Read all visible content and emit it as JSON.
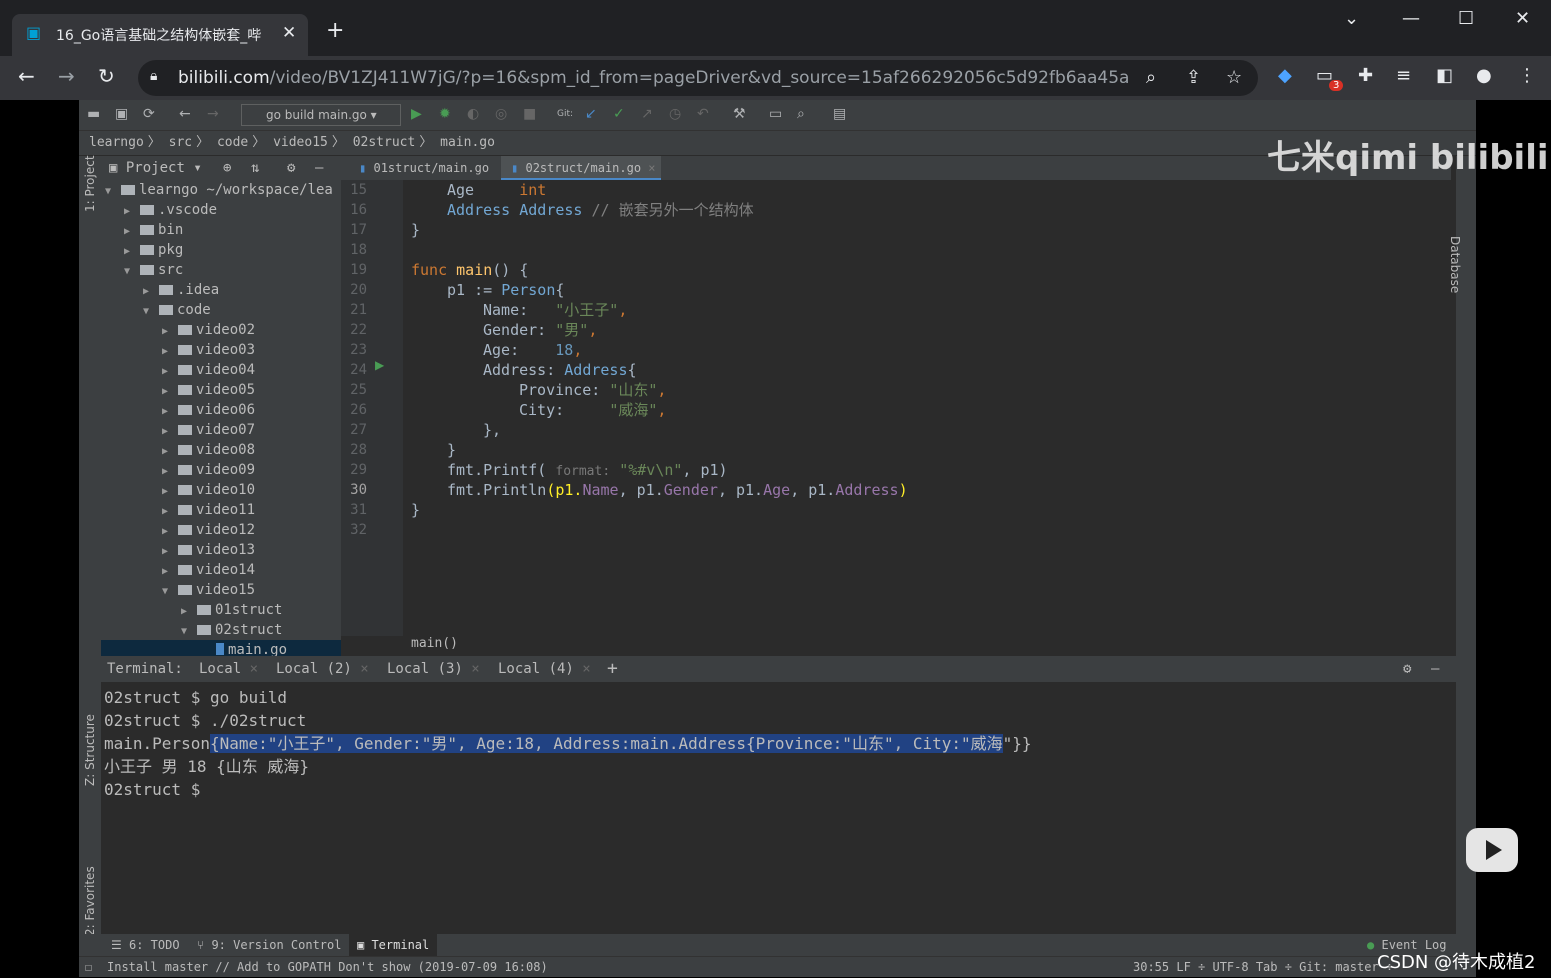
{
  "browser": {
    "tab_title": "16_Go语言基础之结构体嵌套_哔",
    "tab_close": "✕",
    "new_tab": "+",
    "url_host": "bilibili.com",
    "url_path": "/video/BV1ZJ411W7jG/?p=16&spm_id_from=pageDriver&vd_source=15af266292056c5d92fb6aa45a...",
    "extension_badge": "3"
  },
  "ide": {
    "run_config": "go build main.go",
    "git_label": "Git:",
    "breadcrumb": [
      "learngo",
      "src",
      "code",
      "video15",
      "02struct",
      "main.go"
    ],
    "project_panel": {
      "title": "Project",
      "side_label": "1: Project",
      "tree": [
        {
          "label": "learngo  ~/workspace/lea",
          "depth": 0,
          "open": true
        },
        {
          "label": ".vscode",
          "depth": 1,
          "open": false
        },
        {
          "label": "bin",
          "depth": 1,
          "open": false
        },
        {
          "label": "pkg",
          "depth": 1,
          "open": false
        },
        {
          "label": "src",
          "depth": 1,
          "open": true
        },
        {
          "label": ".idea",
          "depth": 2,
          "open": false
        },
        {
          "label": "code",
          "depth": 2,
          "open": true
        },
        {
          "label": "video02",
          "depth": 3,
          "open": false
        },
        {
          "label": "video03",
          "depth": 3,
          "open": false
        },
        {
          "label": "video04",
          "depth": 3,
          "open": false
        },
        {
          "label": "video05",
          "depth": 3,
          "open": false
        },
        {
          "label": "video06",
          "depth": 3,
          "open": false
        },
        {
          "label": "video07",
          "depth": 3,
          "open": false
        },
        {
          "label": "video08",
          "depth": 3,
          "open": false
        },
        {
          "label": "video09",
          "depth": 3,
          "open": false
        },
        {
          "label": "video10",
          "depth": 3,
          "open": false
        },
        {
          "label": "video11",
          "depth": 3,
          "open": false
        },
        {
          "label": "video12",
          "depth": 3,
          "open": false
        },
        {
          "label": "video13",
          "depth": 3,
          "open": false
        },
        {
          "label": "video14",
          "depth": 3,
          "open": false
        },
        {
          "label": "video15",
          "depth": 3,
          "open": true
        },
        {
          "label": "01struct",
          "depth": 4,
          "open": false
        },
        {
          "label": "02struct",
          "depth": 4,
          "open": true
        },
        {
          "label": "main.go",
          "depth": 5,
          "open": null
        }
      ]
    },
    "editor_tabs": [
      "01struct/main.go",
      "02struct/main.go"
    ],
    "line_numbers": [
      "15",
      "16",
      "17",
      "18",
      "19",
      "20",
      "21",
      "22",
      "23",
      "24",
      "25",
      "26",
      "27",
      "28",
      "29",
      "30",
      "31",
      "32"
    ],
    "code_breadcrumb": "main()",
    "code": {
      "l15a": "Age",
      "l15b": "int",
      "l16a": "Address",
      "l16b": "Address",
      "l16c": "// 嵌套另外一个结构体",
      "l17": "}",
      "l19a": "func",
      "l19b": "main",
      "l19c": "() {",
      "l20a": "p1 := ",
      "l20b": "Person",
      "l20c": "{",
      "l21a": "Name:",
      "l21b": "\"小王子\"",
      "l21c": ",",
      "l22a": "Gender:",
      "l22b": "\"男\"",
      "l22c": ",",
      "l23a": "Age:",
      "l23b": "18",
      "l23c": ",",
      "l24a": "Address:",
      "l24b": "Address",
      "l24c": "{",
      "l25a": "Province:",
      "l25b": "\"山东\"",
      "l25c": ",",
      "l26a": "City:",
      "l26b": "\"威海\"",
      "l26c": ",",
      "l27": "},",
      "l28": "}",
      "l29a": "fmt.",
      "l29b": "Printf(",
      "l29c": "format:",
      "l29d": "\"%#v\\n\"",
      "l29e": ", p1)",
      "l30a": "fmt.",
      "l30b": "Println",
      "l30c": "(p1.",
      "l30d": "Name",
      "l30e": ", p1.",
      "l30f": "Gender",
      "l30g": ", p1.",
      "l30h": "Age",
      "l30i": ", p1.",
      "l30j": "Address",
      "l30k": ")",
      "l31": "}"
    },
    "terminal": {
      "label": "Terminal:",
      "tabs": [
        "Local",
        "Local (2)",
        "Local (3)",
        "Local (4)"
      ],
      "add": "+",
      "lines": [
        "02struct $ go build",
        "02struct $ ./02struct"
      ],
      "line3_prefix": "main.Person",
      "line3_selected": "{Name:\"小王子\", Gender:\"男\", Age:18, Address:main.Address{Province:\"山东\", City:\"威海",
      "line3_suffix": "\"}}",
      "line4": "小王子 男 18 {山东 威海}",
      "line5": "02struct $"
    },
    "side_labels": {
      "structure": "Z: Structure",
      "favorites": "2: Favorites",
      "database": "Database"
    },
    "bottom_tools": [
      "6: TODO",
      "9: Version Control",
      "Terminal"
    ],
    "event_log": "Event Log",
    "status_message": "Install master // Add to GOPATH Don't show (2019-07-09 16:08)",
    "status_right": "30:55  LF ÷  UTF-8  Tab ÷  Git: master ÷"
  },
  "watermark": "七米qimi bilibili",
  "csdn": "CSDN @待木成植2",
  "colors": {
    "accent_blue": "#00a1d6",
    "selection": "#214283",
    "keyword": "#cc7832",
    "string": "#6a8759",
    "number": "#6897bb"
  }
}
